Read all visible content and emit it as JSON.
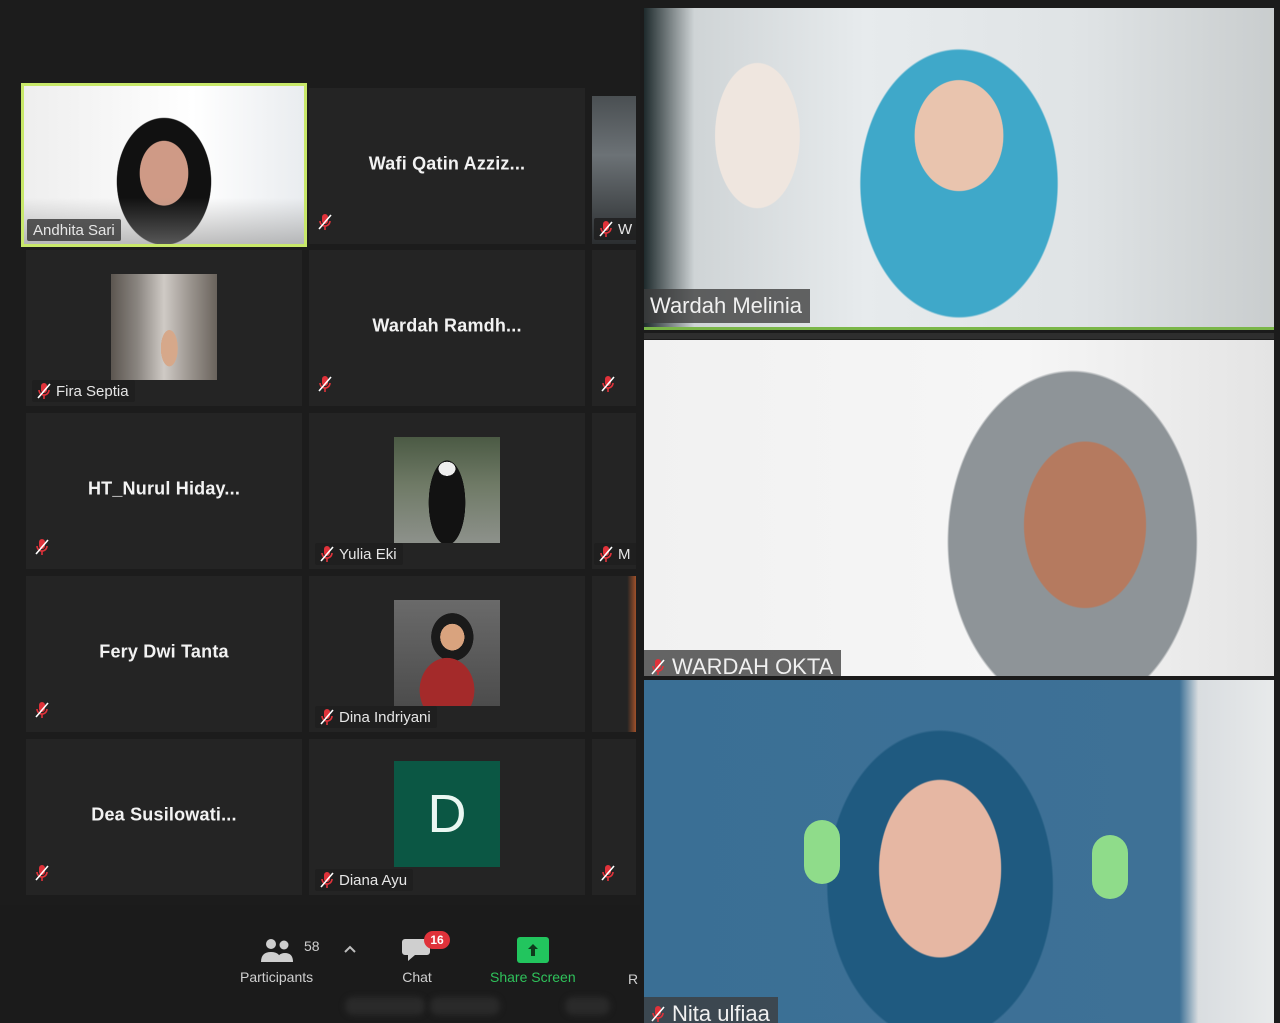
{
  "gallery": {
    "tiles": [
      {
        "name": "Andhita Sari",
        "type": "video",
        "active": true,
        "muted": false
      },
      {
        "name": "Wafi  Qatin  Azziz...",
        "type": "name",
        "muted": true
      },
      {
        "name": "W",
        "type": "video-partial",
        "muted": true
      },
      {
        "name": "Fira Septia",
        "type": "photo",
        "muted": true
      },
      {
        "name": "Wardah  Ramdh...",
        "type": "name",
        "muted": true
      },
      {
        "name": "",
        "type": "partial",
        "muted": true
      },
      {
        "name": "HT_Nurul  Hiday...",
        "type": "name",
        "muted": true
      },
      {
        "name": "Yulia Eki",
        "type": "photo",
        "muted": true
      },
      {
        "name": "M",
        "type": "partial",
        "muted": true
      },
      {
        "name": "Fery Dwi Tanta",
        "type": "name",
        "muted": true
      },
      {
        "name": "Dina Indriyani",
        "type": "photo",
        "muted": true
      },
      {
        "name": "",
        "type": "partial",
        "muted": false
      },
      {
        "name": "Dea  Susilowati...",
        "type": "name",
        "muted": true
      },
      {
        "name": "Diana Ayu",
        "type": "avatar",
        "avatar_letter": "D",
        "avatar_color": "#0b5744",
        "muted": true
      },
      {
        "name": "",
        "type": "partial",
        "muted": true
      }
    ]
  },
  "toolbar": {
    "participants_label": "Participants",
    "participants_count": "58",
    "chat_label": "Chat",
    "chat_badge": "16",
    "share_label": "Share Screen",
    "more_partial": "R"
  },
  "speakers": [
    {
      "name": "Wardah Melinia",
      "muted": false
    },
    {
      "name": "WARDAH OKTA",
      "muted": true
    },
    {
      "name": "Nita ulfiaa",
      "muted": true
    }
  ],
  "colors": {
    "active_speaker_border": "#c8e86a",
    "muted_icon": "#e0323a",
    "share_green": "#22c55e",
    "chat_badge": "#e0323a"
  }
}
